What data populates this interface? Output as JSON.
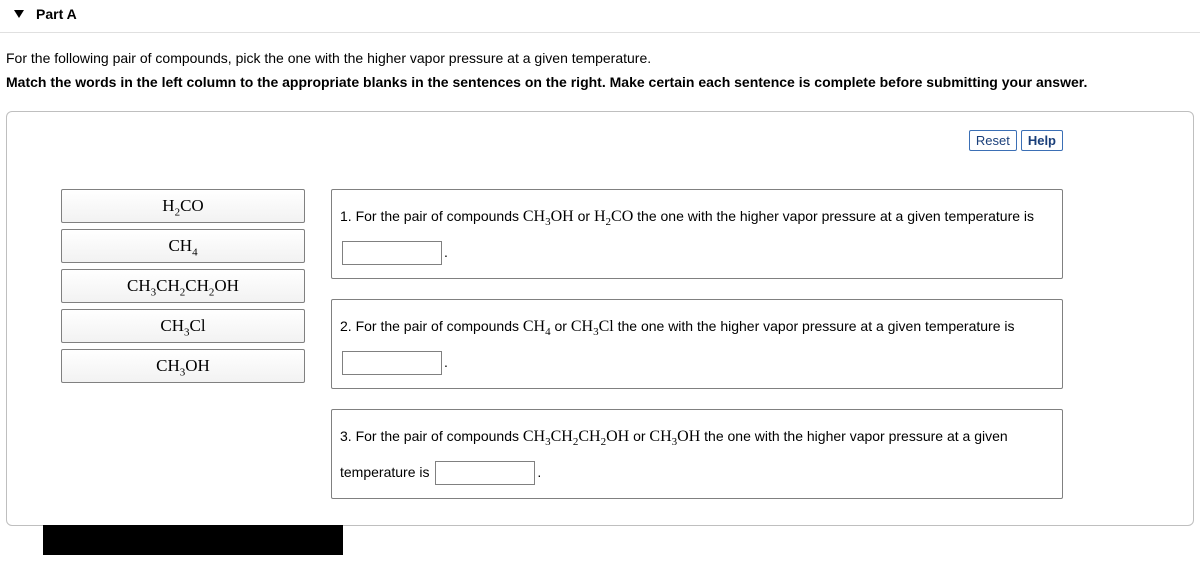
{
  "header": {
    "title": "Part A"
  },
  "instructions": {
    "line1": "For the following pair of compounds, pick the one with the higher vapor pressure at a given temperature.",
    "line2": "Match the words in the left column to the appropriate blanks in the sentences on the right. Make certain each sentence is complete before submitting your answer."
  },
  "top_buttons": {
    "reset": "Reset",
    "help": "Help"
  },
  "tiles": {
    "t1_pre": "H",
    "t1_sub1": "2",
    "t1_post": "CO",
    "t2_pre": "CH",
    "t2_sub1": "4",
    "t3_a": "CH",
    "t3_s1": "3",
    "t3_b": "CH",
    "t3_s2": "2",
    "t3_c": "CH",
    "t3_s3": "2",
    "t3_d": "OH",
    "t4_pre": "CH",
    "t4_sub1": "3",
    "t4_post": "Cl",
    "t5_pre": "CH",
    "t5_sub1": "3",
    "t5_post": "OH"
  },
  "sentences": {
    "s1": {
      "pre": "1. For the pair of compounds ",
      "c1a": "CH",
      "c1as": "3",
      "c1b": "OH",
      "mid": " or ",
      "c2a": "H",
      "c2as": "2",
      "c2b": "CO",
      "tail1": " the one with the higher vapor pressure at a given temperature is ",
      "period": "."
    },
    "s2": {
      "pre": "2. For the pair of compounds ",
      "c1a": "CH",
      "c1as": "4",
      "mid": " or ",
      "c2a": "CH",
      "c2as": "3",
      "c2b": "Cl",
      "tail1": " the one with the higher vapor pressure at a given temperature is ",
      "period": "."
    },
    "s3": {
      "pre": "3. For the pair of compounds ",
      "c1a": "CH",
      "c1as1": "3",
      "c1b": "CH",
      "c1as2": "2",
      "c1c": "CH",
      "c1as3": "2",
      "c1d": "OH",
      "mid": " or ",
      "c2a": "CH",
      "c2as": "3",
      "c2b": "OH",
      "tail1": " the one with the higher vapor pressure at a given temperature is ",
      "period": "."
    }
  }
}
